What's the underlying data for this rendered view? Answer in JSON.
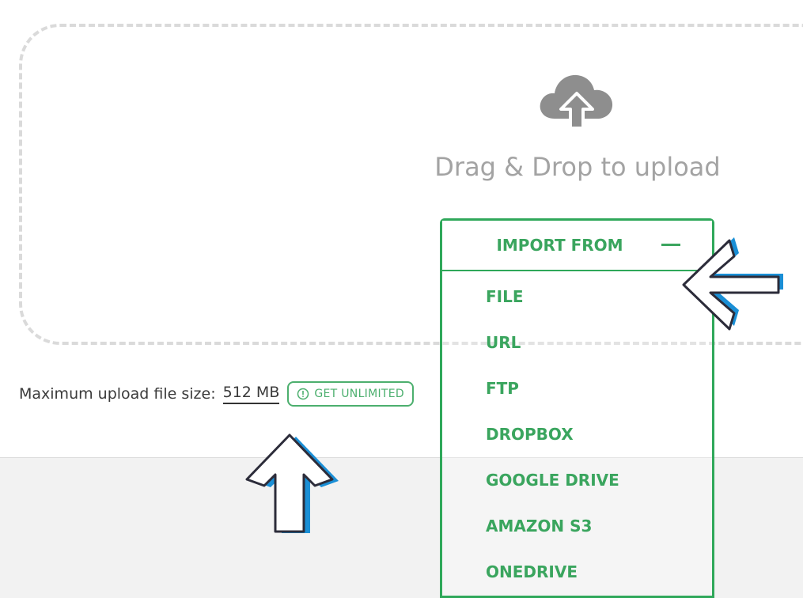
{
  "upload": {
    "drop_text": "Drag & Drop to upload",
    "icon": "cloud-upload-icon"
  },
  "limits": {
    "label": "Maximum upload file size:",
    "size": "512 MB",
    "unlimited_label": "GET UNLIMITED",
    "unlimited_icon": "info-icon"
  },
  "import_menu": {
    "title": "IMPORT FROM",
    "toggle_icon": "minus-icon",
    "items": [
      {
        "label": "FILE"
      },
      {
        "label": "URL"
      },
      {
        "label": "FTP"
      },
      {
        "label": "DROPBOX"
      },
      {
        "label": "GOOGLE DRIVE"
      },
      {
        "label": "AMAZON S3"
      },
      {
        "label": "ONEDRIVE"
      }
    ]
  },
  "colors": {
    "accent_green": "#3aa55e",
    "drop_border": "#dadada",
    "arrow_blue": "#1a8fd6"
  }
}
